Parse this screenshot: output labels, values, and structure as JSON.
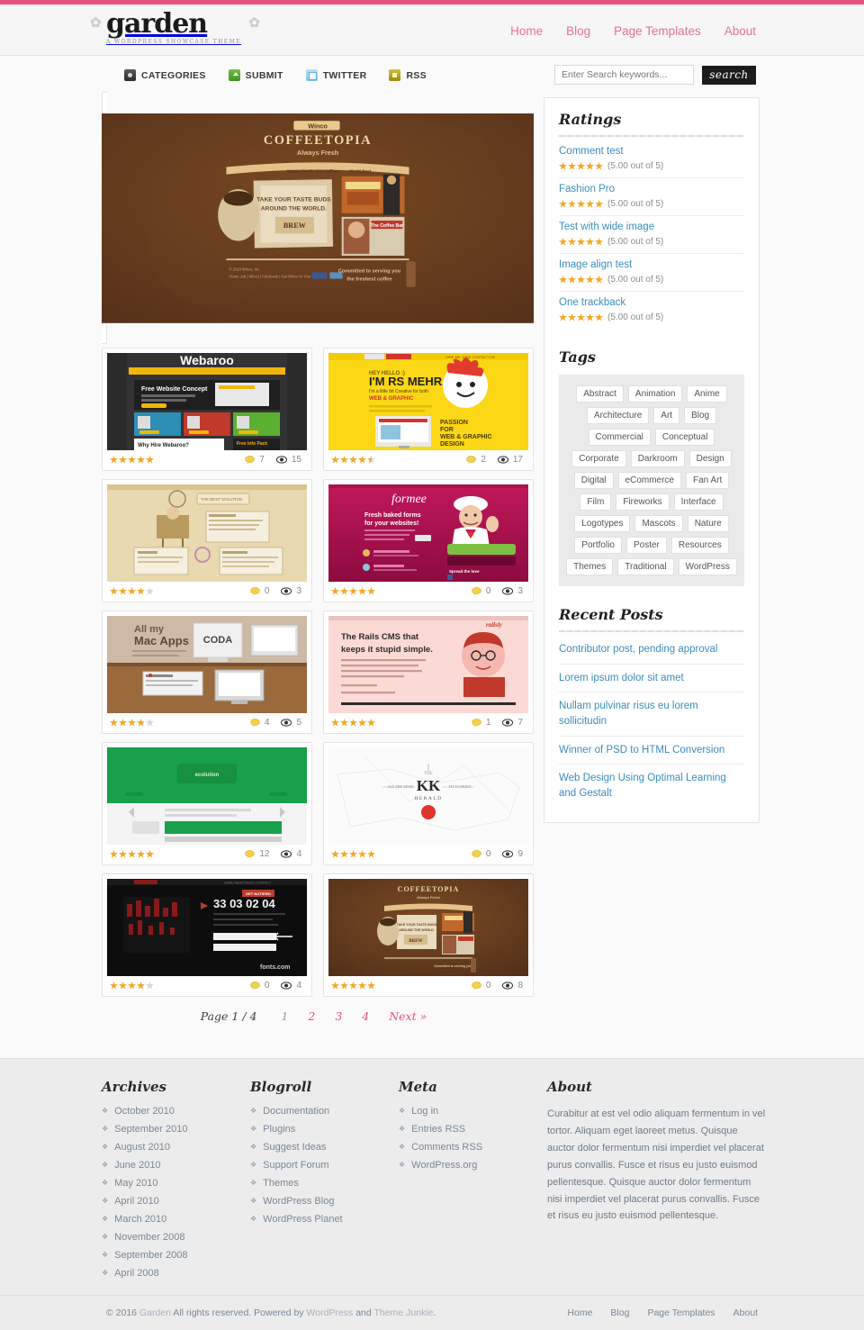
{
  "site": {
    "logo": "garden",
    "tagline": "A WORDPRESS SHOWCASE THEME"
  },
  "header": {
    "nav": [
      {
        "label": "Home"
      },
      {
        "label": "Blog"
      },
      {
        "label": "Page Templates"
      },
      {
        "label": "About"
      }
    ]
  },
  "utilbar": {
    "items": [
      {
        "label": "CATEGORIES",
        "icon": "categories-icon"
      },
      {
        "label": "SUBMIT",
        "icon": "submit-icon"
      },
      {
        "label": "TWITTER",
        "icon": "twitter-icon"
      },
      {
        "label": "RSS",
        "icon": "rss-icon"
      }
    ]
  },
  "search": {
    "placeholder": "Enter Search keywords...",
    "value": "",
    "button_label": "search"
  },
  "featured": {
    "title": "Coffeetopia",
    "caption": "COFFEETOPIA",
    "subcaption": "Always Fresh"
  },
  "items": [
    {
      "name": "webaroo",
      "rating": 5,
      "comments": "7",
      "views": "15"
    },
    {
      "name": "rs-mehra",
      "rating": 4.5,
      "comments": "2",
      "views": "17"
    },
    {
      "name": "illustration-site",
      "rating": 4,
      "comments": "0",
      "views": "3"
    },
    {
      "name": "formee",
      "rating": 5,
      "comments": "0",
      "views": "3"
    },
    {
      "name": "mac-apps",
      "rating": 4,
      "comments": "4",
      "views": "5"
    },
    {
      "name": "rails-cms",
      "rating": 5,
      "comments": "1",
      "views": "7"
    },
    {
      "name": "green-site",
      "rating": 5,
      "comments": "12",
      "views": "4"
    },
    {
      "name": "kk-herald",
      "rating": 5,
      "comments": "0",
      "views": "9"
    },
    {
      "name": "countdown-site",
      "rating": 4,
      "comments": "0",
      "views": "4"
    },
    {
      "name": "coffeetopia",
      "rating": 5,
      "comments": "0",
      "views": "8"
    }
  ],
  "pagination": {
    "label": "Page 1 / 4",
    "pages": [
      "1",
      "2",
      "3",
      "4"
    ],
    "current": "1",
    "next": "Next »"
  },
  "sidebar": {
    "ratings_title": "Ratings",
    "ratings": [
      {
        "title": "Comment test",
        "score": "(5.00 out of 5)",
        "stars": 5
      },
      {
        "title": "Fashion Pro",
        "score": "(5.00 out of 5)",
        "stars": 5
      },
      {
        "title": "Test with wide image",
        "score": "(5.00 out of 5)",
        "stars": 5
      },
      {
        "title": "Image align test",
        "score": "(5.00 out of 5)",
        "stars": 5
      },
      {
        "title": "One trackback",
        "score": "(5.00 out of 5)",
        "stars": 5
      }
    ],
    "tags_title": "Tags",
    "tags": [
      "Abstract",
      "Animation",
      "Anime",
      "Architecture",
      "Art",
      "Blog",
      "Commercial",
      "Conceptual",
      "Corporate",
      "Darkroom",
      "Design",
      "Digital",
      "eCommerce",
      "Fan Art",
      "Film",
      "Fireworks",
      "Interface",
      "Logotypes",
      "Mascots",
      "Nature",
      "Portfolio",
      "Poster",
      "Resources",
      "Themes",
      "Traditional",
      "WordPress"
    ],
    "recent_title": "Recent Posts",
    "recent": [
      "Contributor post, pending approval",
      "Lorem ipsum dolor sit amet",
      "Nullam pulvinar risus eu lorem sollicitudin",
      "Winner of PSD to HTML Conversion",
      "Web Design Using Optimal Learning and Gestalt"
    ]
  },
  "footer": {
    "archives_title": "Archives",
    "archives": [
      "October 2010",
      "September 2010",
      "August 2010",
      "June 2010",
      "May 2010",
      "April 2010",
      "March 2010",
      "November 2008",
      "September 2008",
      "April 2008"
    ],
    "blogroll_title": "Blogroll",
    "blogroll": [
      "Documentation",
      "Plugins",
      "Suggest Ideas",
      "Support Forum",
      "Themes",
      "WordPress Blog",
      "WordPress Planet"
    ],
    "meta_title": "Meta",
    "meta": [
      "Log in",
      "Entries RSS",
      "Comments RSS",
      "WordPress.org"
    ],
    "about_title": "About",
    "about_text": "Curabitur at est vel odio aliquam fermentum in vel tortor. Aliquam eget laoreet metus. Quisque auctor dolor fermentum nisi imperdiet vel placerat purus convallis. Fusce et risus eu justo euismod pellentesque. Quisque auctor dolor fermentum nisi imperdiet vel placerat purus convallis. Fusce et risus eu justo euismod pellentesque."
  },
  "bottom": {
    "copyright_pre": "© 2016 ",
    "copyright_brand": "Garden",
    "copyright_mid": " All rights reserved. Powered by ",
    "copyright_wp": "WordPress",
    "copyright_and": " and ",
    "copyright_tj": "Theme Junkie",
    "copyright_end": ".",
    "nav": [
      "Home",
      "Blog",
      "Page Templates",
      "About"
    ]
  },
  "colors": {
    "accent_pink": "#e8537c",
    "nav_pink": "#e8718e",
    "link_blue": "#3b8dbd",
    "star_gold": "#f5a623",
    "footer_link": "#7a8796"
  }
}
